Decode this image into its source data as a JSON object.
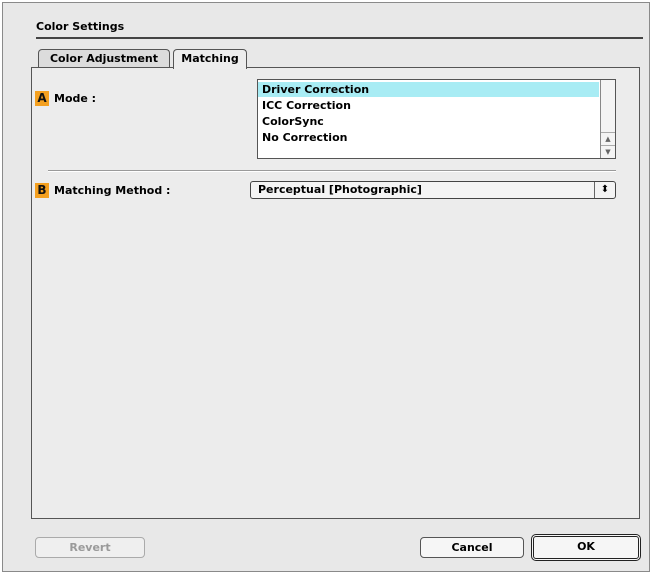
{
  "window": {
    "title": "Color Settings"
  },
  "tabs": [
    {
      "label": "Color Adjustment",
      "active": false
    },
    {
      "label": "Matching",
      "active": true
    }
  ],
  "mode": {
    "badge": "A",
    "label": "Mode :",
    "options": [
      "Driver Correction",
      "ICC Correction",
      "ColorSync",
      "No Correction"
    ],
    "selected": "Driver Correction",
    "selected_color": "#a8ecf4"
  },
  "matching_method": {
    "badge": "B",
    "label": "Matching Method :",
    "value": "Perceptual [Photographic]"
  },
  "buttons": {
    "revert": "Revert",
    "cancel": "Cancel",
    "ok": "OK"
  },
  "colors": {
    "badge": "#f4a020",
    "window_bg": "#e8e8e8"
  },
  "icons": {
    "scroll_up": "scroll-up-arrow-icon",
    "scroll_down": "scroll-down-arrow-icon",
    "select_arrows": "updown-arrows-icon"
  }
}
